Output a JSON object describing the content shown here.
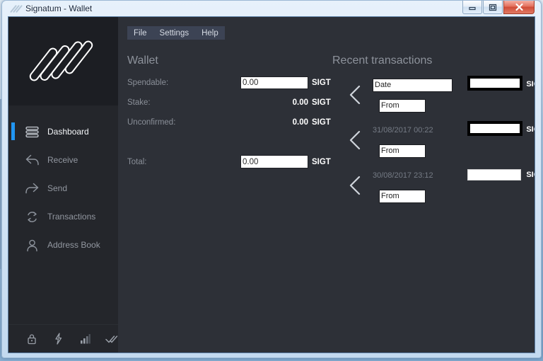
{
  "window": {
    "title": "Signatum - Wallet",
    "logo_icon": "signatum-logo-icon",
    "controls": [
      {
        "name": "minimize-button",
        "icon": "minimize-icon"
      },
      {
        "name": "maximize-button",
        "icon": "maximize-icon"
      },
      {
        "name": "close-button",
        "icon": "close-icon"
      }
    ]
  },
  "menubar": {
    "items": [
      {
        "label": "File",
        "name": "menu-file"
      },
      {
        "label": "Settings",
        "name": "menu-settings"
      },
      {
        "label": "Help",
        "name": "menu-help"
      }
    ]
  },
  "sidebar": {
    "brand_icon": "signatum-logo-icon",
    "items": [
      {
        "label": "Dashboard",
        "icon": "dashboard-icon",
        "active": true
      },
      {
        "label": "Receive",
        "icon": "receive-arrow-icon",
        "active": false
      },
      {
        "label": "Send",
        "icon": "send-arrow-icon",
        "active": false
      },
      {
        "label": "Transactions",
        "icon": "refresh-icon",
        "active": false
      },
      {
        "label": "Address Book",
        "icon": "person-icon",
        "active": false
      }
    ],
    "active_indicator_color": "#2196f3"
  },
  "statusbar": {
    "icons": [
      {
        "name": "lock-icon"
      },
      {
        "name": "staking-bolt-icon"
      },
      {
        "name": "connection-bars-icon"
      },
      {
        "name": "sync-check-icon"
      }
    ]
  },
  "wallet": {
    "title": "Wallet",
    "rows": [
      {
        "label": "Spendable:",
        "value": "0.00",
        "unit": "SIGT",
        "redacted": true
      },
      {
        "label": "Stake:",
        "value": "0.00",
        "unit": "SIGT",
        "redacted": false
      },
      {
        "label": "Unconfirmed:",
        "value": "0.00",
        "unit": "SIGT",
        "redacted": false
      }
    ],
    "total": {
      "label": "Total:",
      "value": "0.00",
      "unit": "SIGT",
      "redacted": true
    }
  },
  "transactions": {
    "title": "Recent transactions",
    "rows": [
      {
        "direction_icon": "incoming-chevron-icon",
        "date": "Date",
        "date_boxed": true,
        "from": "From",
        "plus": "+",
        "unit": "SIGT",
        "amount_redaction": "thick"
      },
      {
        "direction_icon": "incoming-chevron-icon",
        "date": "31/08/2017 00:22",
        "date_boxed": false,
        "from": "From",
        "plus": "+",
        "unit": "SIGT",
        "amount_redaction": "thick"
      },
      {
        "direction_icon": "incoming-chevron-icon",
        "date": "30/08/2017 23:12",
        "date_boxed": false,
        "from": "From",
        "plus": "+",
        "unit": "SIGT",
        "amount_redaction": "thin"
      }
    ]
  },
  "colors": {
    "app_background": "#2d3037",
    "sidebar_background": "#24262b",
    "logo_panel_background": "#1c1e23",
    "menubar_background": "#3c4354",
    "accent": "#2196f3",
    "muted_text": "#8a8f98",
    "bright_text": "#ffffff"
  }
}
